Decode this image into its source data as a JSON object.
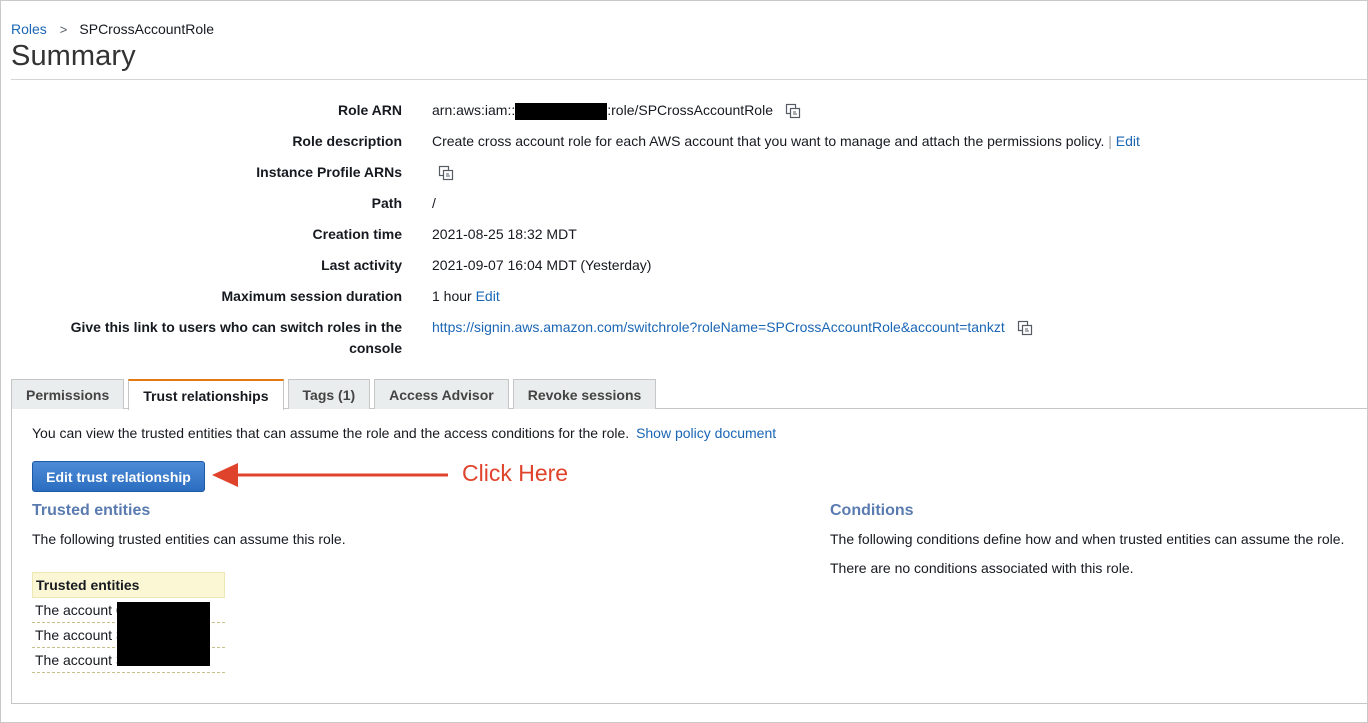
{
  "breadcrumb": {
    "parent": "Roles",
    "separator": ">",
    "current": "SPCrossAccountRole"
  },
  "page_title": "Summary",
  "summary": {
    "role_arn": {
      "label": "Role ARN",
      "prefix": "arn:aws:iam::",
      "suffix": ":role/SPCrossAccountRole"
    },
    "role_description": {
      "label": "Role description",
      "value": "Create cross account role for each AWS account that you want to manage and attach the permissions policy.",
      "separator": "|",
      "edit_label": "Edit"
    },
    "instance_profile_arns": {
      "label": "Instance Profile ARNs"
    },
    "path": {
      "label": "Path",
      "value": "/"
    },
    "creation_time": {
      "label": "Creation time",
      "value": "2021-08-25 18:32 MDT"
    },
    "last_activity": {
      "label": "Last activity",
      "value": "2021-09-07 16:04 MDT (Yesterday)"
    },
    "max_session": {
      "label": "Maximum session duration",
      "value": "1 hour",
      "edit_label": "Edit"
    },
    "switch_link": {
      "label_line1": "Give this link to users who can switch roles in the",
      "label_line2": "console",
      "url": "https://signin.aws.amazon.com/switchrole?roleName=SPCrossAccountRole&account=tankzt"
    }
  },
  "tabs": [
    {
      "label": "Permissions",
      "active": false
    },
    {
      "label": "Trust relationships",
      "active": true
    },
    {
      "label": "Tags (1)",
      "active": false
    },
    {
      "label": "Access Advisor",
      "active": false
    },
    {
      "label": "Revoke sessions",
      "active": false
    }
  ],
  "trust_panel": {
    "intro": "You can view the trusted entities that can assume the role and the access conditions for the role.",
    "show_policy_label": "Show policy document",
    "edit_button_label": "Edit trust relationship",
    "annotation": "Click Here",
    "trusted_entities": {
      "title": "Trusted entities",
      "description": "The following trusted entities can assume this role.",
      "column_header": "Trusted entities",
      "rows": [
        "The account 0",
        "The account 3",
        "The account 3"
      ]
    },
    "conditions": {
      "title": "Conditions",
      "description": "The following conditions define how and when trusted entities can assume the role.",
      "empty_message": "There are no conditions associated with this role."
    }
  },
  "colors": {
    "link": "#1a66b5",
    "active_tab_accent": "#e47911",
    "primary_button": "#2b6dc0",
    "annotation": "#e0432b",
    "section_title": "#5a7bb0",
    "trusted_header_bg": "#fbf7d4"
  },
  "icons": {
    "copy": "copy-icon",
    "breadcrumb_separator": "chevron-right-icon"
  }
}
